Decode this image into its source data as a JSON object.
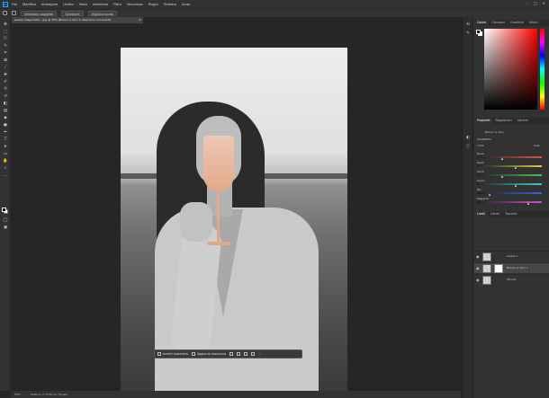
{
  "app": {
    "logo": "Ps",
    "menu": [
      "File",
      "Modifica",
      "Immagine",
      "Livello",
      "Testo",
      "Selezione",
      "Filtro",
      "Visualizza",
      "Plugin",
      "Finestra",
      "Aiuto"
    ]
  },
  "options_bar": {
    "items": [
      "Seleziona soggetto",
      "Selezione",
      "Migliora bordo"
    ]
  },
  "document_tab": {
    "title": "pexels-malgorzata-...jpg @ 25% (Bianco e nero 1, Maschera di livello/8)",
    "close": "×"
  },
  "task_bar": {
    "invert_label": "Inverti maschera",
    "modify_label": "Aggiorna maschera"
  },
  "status_bar": {
    "zoom": "25%",
    "info": "2480 px × 3720 px (72 ppi)"
  },
  "right_panels": {
    "color_tabs": [
      "Colore",
      "Campioni",
      "Gradienti",
      "Motivi"
    ],
    "properties_tabs": [
      "Proprietà",
      "Regolazioni",
      "Librerie"
    ],
    "properties_title": "Bianco e nero",
    "preset_label": "Predefinito",
    "tint_label": "Tinta",
    "auto_label": "Auto",
    "sliders": [
      {
        "name": "Rossi",
        "value": 40,
        "color": "#e05050"
      },
      {
        "name": "Gialli",
        "value": 60,
        "color": "#d8c840"
      },
      {
        "name": "Verdi",
        "value": 40,
        "color": "#50c050"
      },
      {
        "name": "Ciano",
        "value": 60,
        "color": "#40c8c8"
      },
      {
        "name": "Blu",
        "value": 20,
        "color": "#4060e0"
      },
      {
        "name": "Magenta",
        "value": 80,
        "color": "#d050d0"
      }
    ],
    "layers_tabs": [
      "Livelli",
      "Canali",
      "Tracciati"
    ],
    "layers": [
      {
        "name": "Livello 1",
        "selected": false,
        "has_mask": false
      },
      {
        "name": "Bianco e nero 1",
        "selected": true,
        "has_mask": true
      },
      {
        "name": "Sfondo",
        "selected": false,
        "has_mask": false
      }
    ]
  }
}
